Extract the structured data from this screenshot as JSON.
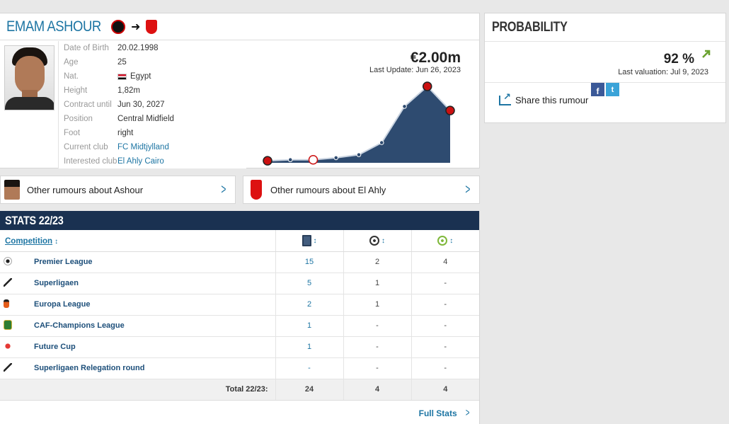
{
  "player": {
    "name": "EMAM ASHOUR",
    "photo": "player-photo",
    "from_club_icon": "fc-midtjylland-crest-icon",
    "to_club_icon": "al-ahly-crest-icon",
    "details": [
      {
        "label": "Date of Birth",
        "value": "20.02.1998"
      },
      {
        "label": "Age",
        "value": "25"
      },
      {
        "label": "Nat.",
        "value": "Egypt",
        "flag": "egypt-flag-icon"
      },
      {
        "label": "Height",
        "value": "1,82m"
      },
      {
        "label": "Contract until",
        "value": "Jun 30, 2027"
      },
      {
        "label": "Position",
        "value": "Central Midfield"
      },
      {
        "label": "Foot",
        "value": "right"
      },
      {
        "label": "Current club",
        "value": "FC Midtjylland",
        "link": true
      },
      {
        "label": "Interested club",
        "value": "El Ahly Cairo",
        "link": true
      }
    ],
    "market_value": "€2.00m",
    "last_update": "Last Update: Jun 26, 2023",
    "colors": {
      "link": "#1d75a3",
      "chart_fill": "#2e4b70",
      "stats_header": "#1a3151"
    }
  },
  "chart_data": {
    "type": "area",
    "values": [
      0.1,
      0.15,
      0.15,
      0.25,
      0.4,
      1.0,
      2.8,
      3.8,
      2.6
    ],
    "points_with_crest": [
      0,
      2,
      7,
      8
    ]
  },
  "rumours": [
    {
      "label": "Other rumours about Ashour",
      "icon": "player-thumbnail-icon"
    },
    {
      "label": "Other rumours about El Ahly",
      "icon": "al-ahly-crest-icon"
    }
  ],
  "stats": {
    "title": "STATS 22/23",
    "competition_header": "Competition",
    "column_icons": [
      "appearances-icon",
      "goals-icon",
      "assists-icon"
    ],
    "rows": [
      {
        "competition": "Premier League",
        "logo": "premier-league-logo",
        "apps": "15",
        "goals": "2",
        "assists": "4"
      },
      {
        "competition": "Superligaen",
        "logo": "superligaen-logo",
        "apps": "5",
        "goals": "1",
        "assists": "-"
      },
      {
        "competition": "Europa League",
        "logo": "europa-league-logo",
        "apps": "2",
        "goals": "1",
        "assists": "-"
      },
      {
        "competition": "CAF-Champions League",
        "logo": "caf-champions-league-logo",
        "apps": "1",
        "goals": "-",
        "assists": "-"
      },
      {
        "competition": "Future Cup",
        "logo": "future-cup-logo",
        "apps": "1",
        "goals": "-",
        "assists": "-"
      },
      {
        "competition": "Superligaen Relegation round",
        "logo": "superligaen-logo",
        "apps": "-",
        "goals": "-",
        "assists": "-"
      }
    ],
    "total": {
      "label": "Total 22/23:",
      "apps": "24",
      "goals": "4",
      "assists": "4"
    },
    "full_stats": "Full Stats"
  },
  "probability": {
    "title": "PROBABILITY",
    "value": "92 %",
    "trend": "up",
    "last_valuation": "Last valuation: Jul 9, 2023",
    "share_label": "Share this rumour",
    "share_buttons": [
      "facebook-icon",
      "twitter-icon"
    ]
  }
}
